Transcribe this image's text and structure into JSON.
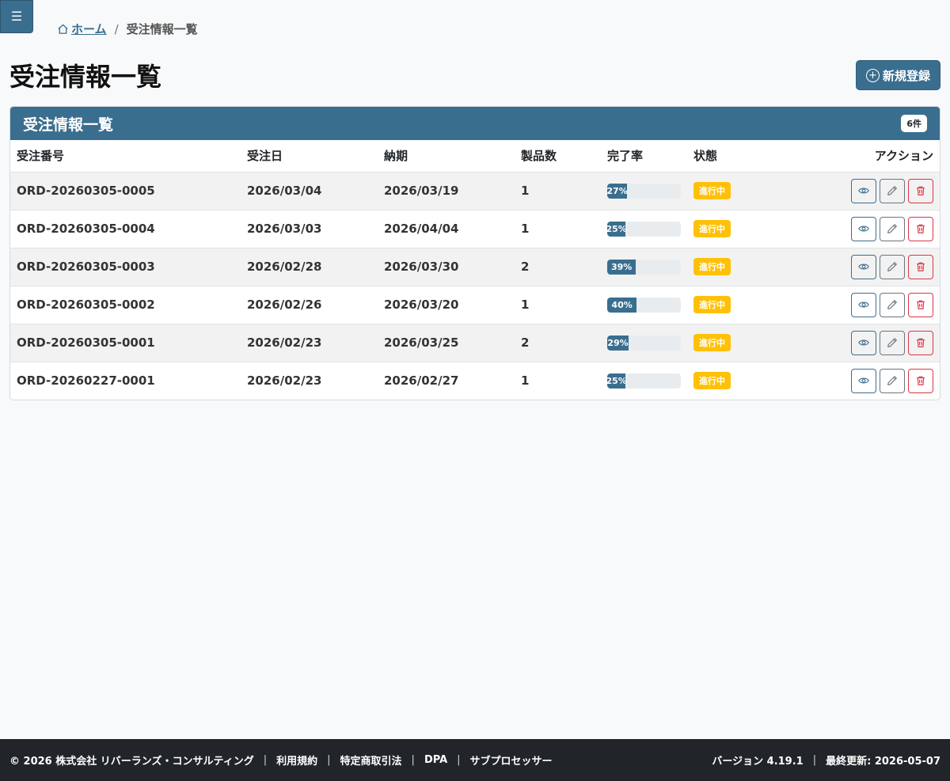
{
  "menu": {
    "toggle_label": "☰"
  },
  "breadcrumb": {
    "home": "ホーム",
    "separator": "/",
    "current": "受注情報一覧"
  },
  "page": {
    "title": "受注情報一覧",
    "new_button": "新規登録"
  },
  "card": {
    "title": "受注情報一覧",
    "count": "6件"
  },
  "table": {
    "headers": [
      "受注番号",
      "受注日",
      "納期",
      "製品数",
      "完了率",
      "状態",
      "アクション"
    ],
    "rows": [
      {
        "order_no": "ORD-20260305-0005",
        "order_date": "2026/03/04",
        "due_date": "2026/03/19",
        "products": "1",
        "progress": "27%",
        "progress_value": 27,
        "status": "進行中"
      },
      {
        "order_no": "ORD-20260305-0004",
        "order_date": "2026/03/03",
        "due_date": "2026/04/04",
        "products": "1",
        "progress": "25%",
        "progress_value": 25,
        "status": "進行中"
      },
      {
        "order_no": "ORD-20260305-0003",
        "order_date": "2026/02/28",
        "due_date": "2026/03/30",
        "products": "2",
        "progress": "39%",
        "progress_value": 39,
        "status": "進行中"
      },
      {
        "order_no": "ORD-20260305-0002",
        "order_date": "2026/02/26",
        "due_date": "2026/03/20",
        "products": "1",
        "progress": "40%",
        "progress_value": 40,
        "status": "進行中"
      },
      {
        "order_no": "ORD-20260305-0001",
        "order_date": "2026/02/23",
        "due_date": "2026/03/25",
        "products": "2",
        "progress": "29%",
        "progress_value": 29,
        "status": "進行中"
      },
      {
        "order_no": "ORD-20260227-0001",
        "order_date": "2026/02/23",
        "due_date": "2026/02/27",
        "products": "1",
        "progress": "25%",
        "progress_value": 25,
        "status": "進行中"
      }
    ]
  },
  "footer": {
    "copyright": "© 2026 株式会社 リバーランズ・コンサルティング",
    "links": [
      "利用規約",
      "特定商取引法",
      "DPA",
      "サブプロセッサー"
    ],
    "separator": "|",
    "version": "バージョン 4.19.1",
    "updated": "最終更新: 2026-05-07"
  },
  "colors": {
    "primary": "#3a6e8f",
    "warning": "#ffc107",
    "danger": "#dc3545",
    "footer_bg": "#212529"
  },
  "icons": {
    "home": "home-icon",
    "plus": "plus-circle-icon",
    "view": "eye-icon",
    "edit": "pencil-icon",
    "delete": "trash-icon"
  }
}
